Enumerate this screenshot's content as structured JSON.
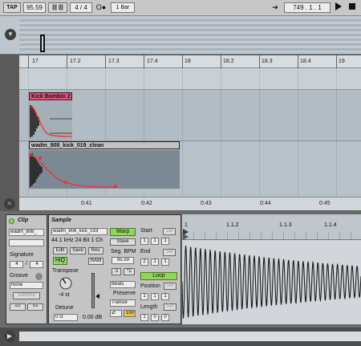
{
  "transport": {
    "tap": "TAP",
    "tempo": "95.59",
    "nudge_icons": "|||  |||",
    "signature": "4 / 4",
    "metronome_icon": "O●",
    "quantize": "1 Bar",
    "follow_icon": "➔",
    "position": "749 .  1 .  1"
  },
  "ruler": {
    "bars": [
      "17",
      "17.2",
      "17.3",
      "17.4",
      "18",
      "18.2",
      "18.3",
      "18.4",
      "19"
    ]
  },
  "clips": {
    "top_name": "Kick Bombin 2",
    "bottom_name": "wadm_808_kick_019_clean",
    "top_color": "#e8517d",
    "bottom_color": "#c2c2c2"
  },
  "timeline": {
    "labels": [
      "0:41",
      "0:42",
      "0:43",
      "0:44",
      "0:45"
    ]
  },
  "clip_panel": {
    "title": "Clip",
    "name": "wadm_808_",
    "signature_label": "Signature",
    "sig_num": "4",
    "sig_den": "4",
    "groove_label": "Groove",
    "groove_value": "None",
    "commit": "Commit",
    "nav_left": "<<",
    "nav_right": ">>"
  },
  "sample_panel": {
    "title": "Sample",
    "name": "wadm_808_kick_019",
    "info": "44.1 kHz 24 Bit 1 Ch",
    "edit": "Edit",
    "save": "Save",
    "rev": "Rev.",
    "hiq": "HiQ",
    "ram": "RAM",
    "transpose_label": "Transpose",
    "transpose_value": "-4 st",
    "detune_label": "Detune",
    "detune_value": "0 ct",
    "gain_value": "0.00 dB",
    "warp": "Warp",
    "slave": "Slave",
    "seg_bpm_label": "Seg. BPM",
    "seg_bpm": "95.59",
    "half": ":2",
    "double": "*2",
    "mode": "Beats",
    "preserve_label": "Preserve",
    "preserve_value": "Transie",
    "loop_mode": "⇄",
    "percent": "100"
  },
  "loop_panel": {
    "start_label": "Start",
    "start": [
      "1",
      "1",
      "1"
    ],
    "end_label": "End",
    "end": [
      "2",
      "1",
      "1"
    ],
    "set": "Set",
    "loop": "Loop",
    "position_label": "Position",
    "position": [
      "1",
      "1",
      "1"
    ],
    "length_label": "Length",
    "length": [
      "1",
      "0",
      "0"
    ]
  },
  "editor": {
    "bars": [
      "1",
      "1.1.2",
      "1.1.3",
      "1.1.4"
    ]
  }
}
